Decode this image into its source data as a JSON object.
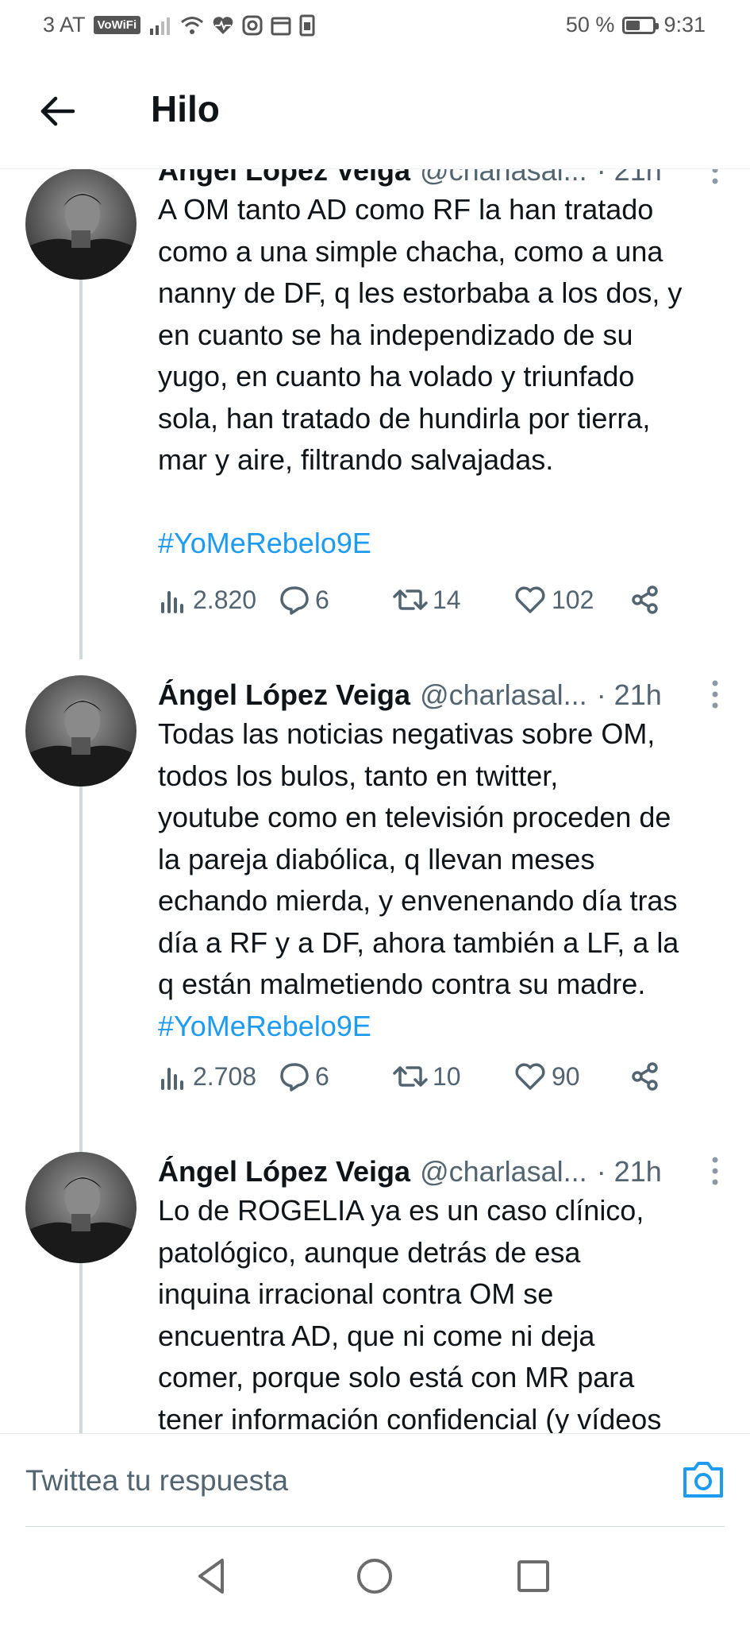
{
  "status_bar": {
    "carrier": "3 AT",
    "vowifi": "VoWiFi",
    "battery": "50 %",
    "battery_level": 0.5,
    "time": "9:31"
  },
  "header": {
    "title": "Hilo"
  },
  "tweets": [
    {
      "name": "Ángel López Veiga",
      "handle": "@charlasal...",
      "time": "· 21h",
      "text": "A OM tanto AD como RF la han tratado\ncomo a una simple chacha, como a una\nnanny de DF, q les estorbaba a los dos, y\nen cuanto se ha independizado de su\nyugo, en cuanto ha volado y triunfado\nsola, han tratado de hundirla por tierra,\nmar y aire, filtrando salvajadas.\n\n",
      "hashtag": "#YoMeRebelo9E",
      "views": "2.820",
      "replies": "6",
      "retweets": "14",
      "likes": "102"
    },
    {
      "name": "Ángel López Veiga",
      "handle": "@charlasal...",
      "time": "· 21h",
      "text": "Todas las noticias negativas sobre OM,\ntodos los bulos, tanto en twitter,\nyoutube como en televisión proceden de\nla pareja diabólica, q llevan meses\nechando mierda, y envenenando día tras\ndía a RF y a DF, ahora también a LF, a la\nq están malmetiendo contra su madre.\n",
      "hashtag": "#YoMeRebelo9E",
      "views": "2.708",
      "replies": "6",
      "retweets": "10",
      "likes": "90"
    },
    {
      "name": "Ángel López Veiga",
      "handle": "@charlasal...",
      "time": "· 21h",
      "text": "Lo de ROGELIA ya es un caso clínico,\npatológico, aunque detrás de esa\ninquina irracional contra OM se\nencuentra AD, que ni come ni deja\ncomer, porque solo está con MR para\ntener información confidencial (y vídeos",
      "hashtag": ""
    }
  ],
  "reply_bar": {
    "placeholder": "Twittea tu respuesta"
  },
  "colors": {
    "accent": "#1d9bf0",
    "secondary_text": "#536471",
    "thread_line": "#cfd9de"
  },
  "icons": [
    "back-arrow-icon",
    "views-icon",
    "reply-icon",
    "retweet-icon",
    "like-icon",
    "share-icon",
    "more-icon",
    "camera-icon",
    "nav-back-icon",
    "nav-home-icon",
    "nav-recents-icon"
  ]
}
